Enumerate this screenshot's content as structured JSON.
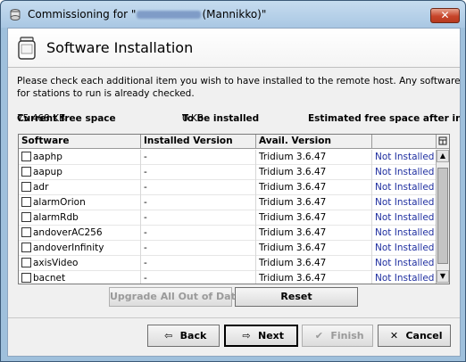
{
  "window": {
    "title_prefix": "Commissioning for \"",
    "title_suffix": "(Mannikko)\"",
    "close_label": "✕"
  },
  "header": {
    "title": "Software Installation"
  },
  "description": {
    "line1": "Please check each additional item you wish to have installed to the remote host.  Any software known",
    "line2": "for stations to run is already checked."
  },
  "space": {
    "current_label": "Current free space",
    "current_value": "75 468 KB",
    "to_install_label": "To be installed",
    "to_install_value": "0 KB",
    "estimated_label": "Estimated free space after in"
  },
  "table": {
    "columns": [
      "Software",
      "Installed Version",
      "Avail. Version",
      ""
    ],
    "rows": [
      {
        "name": "aaphp",
        "installed": "-",
        "available": "Tridium 3.6.47",
        "status": "Not Installed",
        "checked": false
      },
      {
        "name": "aapup",
        "installed": "-",
        "available": "Tridium 3.6.47",
        "status": "Not Installed",
        "checked": false
      },
      {
        "name": "adr",
        "installed": "-",
        "available": "Tridium 3.6.47",
        "status": "Not Installed",
        "checked": false
      },
      {
        "name": "alarmOrion",
        "installed": "-",
        "available": "Tridium 3.6.47",
        "status": "Not Installed",
        "checked": false
      },
      {
        "name": "alarmRdb",
        "installed": "-",
        "available": "Tridium 3.6.47",
        "status": "Not Installed",
        "checked": false
      },
      {
        "name": "andoverAC256",
        "installed": "-",
        "available": "Tridium 3.6.47",
        "status": "Not Installed",
        "checked": false
      },
      {
        "name": "andoverInfinity",
        "installed": "-",
        "available": "Tridium 3.6.47",
        "status": "Not Installed",
        "checked": false
      },
      {
        "name": "axisVideo",
        "installed": "-",
        "available": "Tridium 3.6.47",
        "status": "Not Installed",
        "checked": false
      },
      {
        "name": "bacnet",
        "installed": "-",
        "available": "Tridium 3.6.47",
        "status": "Not Installed",
        "checked": false
      }
    ]
  },
  "actions": {
    "upgrade_all": "Upgrade All Out of Date",
    "reset": "Reset"
  },
  "footer": {
    "back": "Back",
    "next": "Next",
    "finish": "Finish",
    "cancel": "Cancel"
  }
}
